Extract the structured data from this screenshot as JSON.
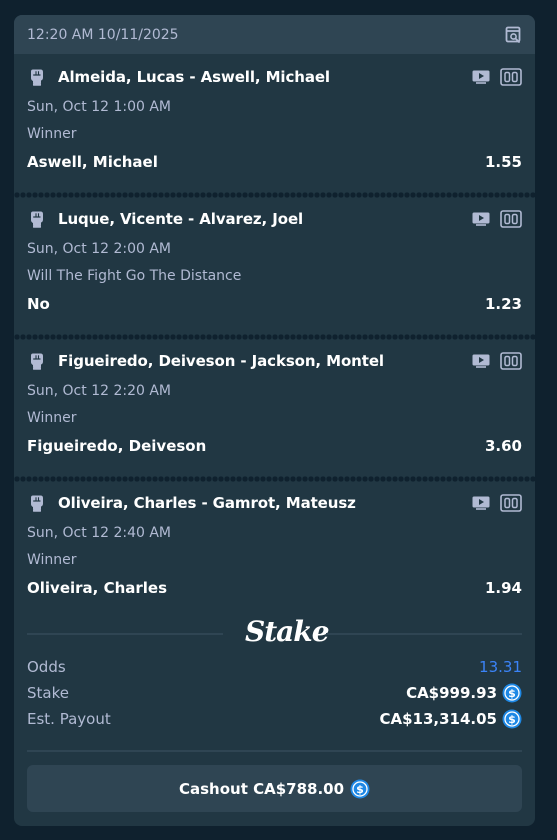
{
  "header": {
    "timestamp": "12:20 AM 10/11/2025"
  },
  "legs": [
    {
      "title": "Almeida, Lucas - Aswell, Michael",
      "date": "Sun, Oct 12  1:00 AM",
      "market": "Winner",
      "selection": "Aswell, Michael",
      "odds": "1.55"
    },
    {
      "title": "Luque, Vicente - Alvarez, Joel",
      "date": "Sun, Oct 12  2:00 AM",
      "market": "Will The Fight Go The Distance",
      "selection": "No",
      "odds": "1.23"
    },
    {
      "title": "Figueiredo, Deiveson - Jackson, Montel",
      "date": "Sun, Oct 12  2:20 AM",
      "market": "Winner",
      "selection": "Figueiredo, Deiveson",
      "odds": "3.60"
    },
    {
      "title": "Oliveira, Charles - Gamrot, Mateusz",
      "date": "Sun, Oct 12  2:40 AM",
      "market": "Winner",
      "selection": "Oliveira, Charles",
      "odds": "1.94"
    }
  ],
  "brand": {
    "logo_text": "Stake"
  },
  "summary": {
    "odds_label": "Odds",
    "odds_value": "13.31",
    "stake_label": "Stake",
    "stake_value": "CA$999.93",
    "payout_label": "Est. Payout",
    "payout_value": "CA$13,314.05"
  },
  "cashout": {
    "label": "Cashout CA$788.00"
  },
  "icons": {
    "header": "receipt-search-icon",
    "sport": "boxing-glove-icon",
    "stream": "live-stream-icon",
    "stats": "scoreboard-icon",
    "currency": "dollar-coin-icon"
  },
  "colors": {
    "background": "#0f212e",
    "card": "#213743",
    "header": "#2f4553",
    "text": "#ffffff",
    "muted": "#b1bad3",
    "accent_blue": "#3b83f7",
    "coin": "#1e88e5"
  }
}
